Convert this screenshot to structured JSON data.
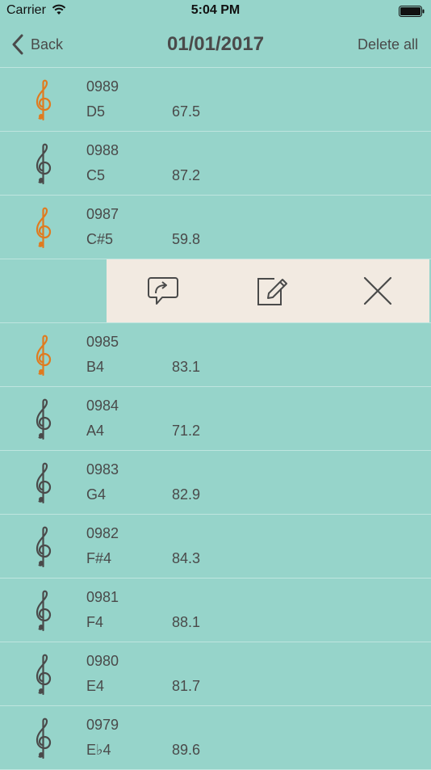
{
  "status_bar": {
    "carrier": "Carrier",
    "time": "5:04 PM"
  },
  "nav": {
    "back_label": "Back",
    "title": "01/01/2017",
    "delete_all_label": "Delete all"
  },
  "colors": {
    "background": "#96d4ca",
    "text": "#4a4a4a",
    "accent_orange": "#e07b1f",
    "action_panel": "#f2eae1"
  },
  "records": [
    {
      "id": "0989",
      "note": "D5",
      "value": "67.5",
      "highlighted": true
    },
    {
      "id": "0988",
      "note": "C5",
      "value": "87.2",
      "highlighted": false
    },
    {
      "id": "0987",
      "note": "C#5",
      "value": "59.8",
      "highlighted": true
    },
    {
      "swiped": true,
      "actions": [
        "share-icon",
        "edit-icon",
        "delete-icon"
      ]
    },
    {
      "id": "0985",
      "note": "B4",
      "value": "83.1",
      "highlighted": true
    },
    {
      "id": "0984",
      "note": "A4",
      "value": "71.2",
      "highlighted": false
    },
    {
      "id": "0983",
      "note": "G4",
      "value": "82.9",
      "highlighted": false
    },
    {
      "id": "0982",
      "note": "F#4",
      "value": "84.3",
      "highlighted": false
    },
    {
      "id": "0981",
      "note": "F4",
      "value": "88.1",
      "highlighted": false
    },
    {
      "id": "0980",
      "note": "E4",
      "value": "81.7",
      "highlighted": false
    },
    {
      "id": "0979",
      "note": "E♭4",
      "value": "89.6",
      "highlighted": false
    }
  ]
}
